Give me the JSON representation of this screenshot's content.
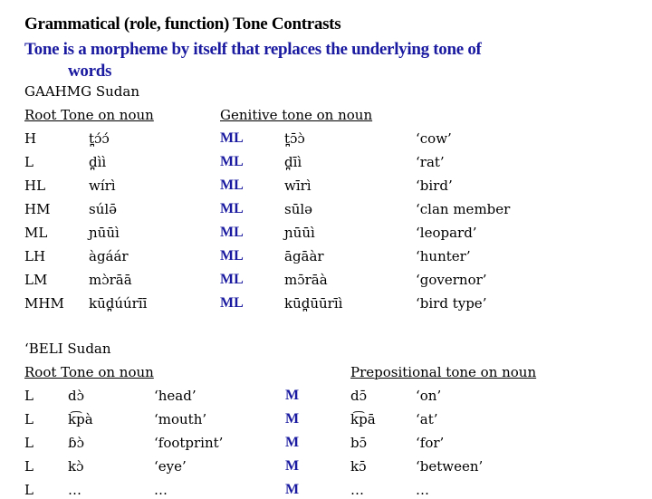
{
  "slide": {
    "title": "Grammatical (role, function) Tone Contrasts",
    "subtitle_line1": "Tone is a morpheme by itself that replaces the underlying tone of",
    "subtitle_line2": "words",
    "accent_color": "#1a1aa0"
  },
  "section1": {
    "language": "GAAHMG Sudan",
    "left_header": "Root Tone on noun",
    "right_header": "Genitive tone on noun",
    "rows": [
      {
        "root_tone": "H",
        "root_form": "t̪ɔ́ɔ́",
        "gen_tone": "ML",
        "gen_form": "t̪ɔ̄ɔ̀",
        "gloss": "‘cow’"
      },
      {
        "root_tone": "L",
        "root_form": "d̪ìì",
        "gen_tone": "ML",
        "gen_form": "d̪īì",
        "gloss": "‘rat’"
      },
      {
        "root_tone": "HL",
        "root_form": "wírì",
        "gen_tone": "ML",
        "gen_form": "wīrì",
        "gloss": "‘bird’"
      },
      {
        "root_tone": "HM",
        "root_form": "súlə̄",
        "gen_tone": "ML",
        "gen_form": "sūlə",
        "gloss": "‘clan member"
      },
      {
        "root_tone": "ML",
        "root_form": "ɲūūì",
        "gen_tone": "ML",
        "gen_form": "ɲūūì",
        "gloss": "‘leopard’"
      },
      {
        "root_tone": "LH",
        "root_form": "àgáár",
        "gen_tone": "ML",
        "gen_form": "āgāàr",
        "gloss": "‘hunter’"
      },
      {
        "root_tone": "LM",
        "root_form": "mɔ̀rāā",
        "gen_tone": "ML",
        "gen_form": "mɔ̄rāà",
        "gloss": "‘governor’"
      },
      {
        "root_tone": "MHM",
        "root_form": "kūd̪úúrīī",
        "gen_tone": "ML",
        "gen_form": "kūd̪ūūrīì",
        "gloss": "‘bird type’"
      }
    ]
  },
  "section2": {
    "language": "‘BELI Sudan",
    "left_header": "Root Tone on noun",
    "right_header": "Prepositional tone on noun",
    "rows": [
      {
        "root_tone": "L",
        "root_form": "dɔ̀",
        "gloss": "‘head’",
        "prep_tone": "M",
        "prep_form": "dɔ̄",
        "prep_gloss": "‘on’"
      },
      {
        "root_tone": "L",
        "root_form": "k͡pà",
        "gloss": "‘mouth’",
        "prep_tone": "M",
        "prep_form": "k͡pā",
        "prep_gloss": "‘at’"
      },
      {
        "root_tone": "L",
        "root_form": "ɓɔ̀",
        "gloss": "‘footprint’",
        "prep_tone": "M",
        "prep_form": "bɔ̄",
        "prep_gloss": "‘for’"
      },
      {
        "root_tone": "L",
        "root_form": "kɔ̀",
        "gloss": "‘eye’",
        "prep_tone": "M",
        "prep_form": "kɔ̄",
        "prep_gloss": "‘between’"
      },
      {
        "root_tone": "L",
        "root_form": "…",
        "gloss": "…",
        "prep_tone": "M",
        "prep_form": "…",
        "prep_gloss": "…"
      }
    ]
  }
}
